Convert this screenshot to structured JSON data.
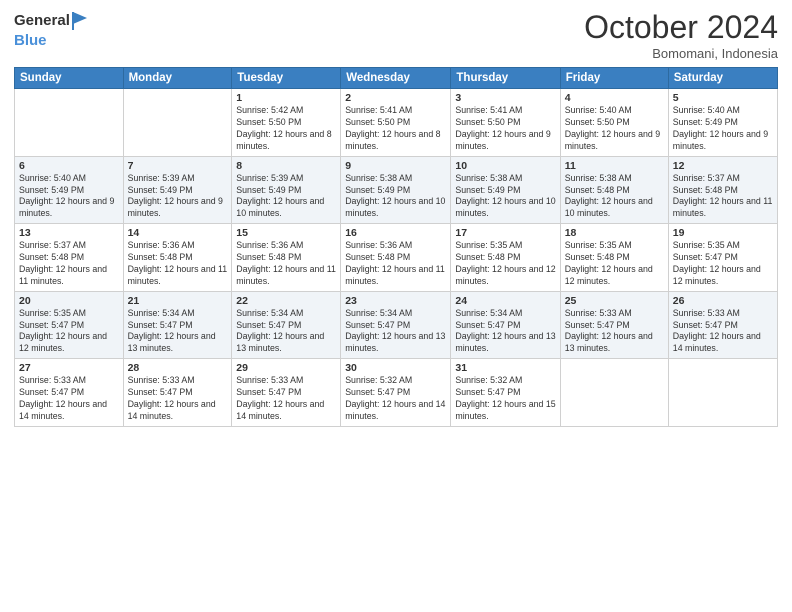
{
  "header": {
    "logo_general": "General",
    "logo_blue": "Blue",
    "month_year": "October 2024",
    "location": "Bomomani, Indonesia"
  },
  "days_of_week": [
    "Sunday",
    "Monday",
    "Tuesday",
    "Wednesday",
    "Thursday",
    "Friday",
    "Saturday"
  ],
  "weeks": [
    [
      {
        "day": "",
        "sunrise": "",
        "sunset": "",
        "daylight": ""
      },
      {
        "day": "",
        "sunrise": "",
        "sunset": "",
        "daylight": ""
      },
      {
        "day": "1",
        "sunrise": "Sunrise: 5:42 AM",
        "sunset": "Sunset: 5:50 PM",
        "daylight": "Daylight: 12 hours and 8 minutes."
      },
      {
        "day": "2",
        "sunrise": "Sunrise: 5:41 AM",
        "sunset": "Sunset: 5:50 PM",
        "daylight": "Daylight: 12 hours and 8 minutes."
      },
      {
        "day": "3",
        "sunrise": "Sunrise: 5:41 AM",
        "sunset": "Sunset: 5:50 PM",
        "daylight": "Daylight: 12 hours and 9 minutes."
      },
      {
        "day": "4",
        "sunrise": "Sunrise: 5:40 AM",
        "sunset": "Sunset: 5:50 PM",
        "daylight": "Daylight: 12 hours and 9 minutes."
      },
      {
        "day": "5",
        "sunrise": "Sunrise: 5:40 AM",
        "sunset": "Sunset: 5:49 PM",
        "daylight": "Daylight: 12 hours and 9 minutes."
      }
    ],
    [
      {
        "day": "6",
        "sunrise": "Sunrise: 5:40 AM",
        "sunset": "Sunset: 5:49 PM",
        "daylight": "Daylight: 12 hours and 9 minutes."
      },
      {
        "day": "7",
        "sunrise": "Sunrise: 5:39 AM",
        "sunset": "Sunset: 5:49 PM",
        "daylight": "Daylight: 12 hours and 9 minutes."
      },
      {
        "day": "8",
        "sunrise": "Sunrise: 5:39 AM",
        "sunset": "Sunset: 5:49 PM",
        "daylight": "Daylight: 12 hours and 10 minutes."
      },
      {
        "day": "9",
        "sunrise": "Sunrise: 5:38 AM",
        "sunset": "Sunset: 5:49 PM",
        "daylight": "Daylight: 12 hours and 10 minutes."
      },
      {
        "day": "10",
        "sunrise": "Sunrise: 5:38 AM",
        "sunset": "Sunset: 5:49 PM",
        "daylight": "Daylight: 12 hours and 10 minutes."
      },
      {
        "day": "11",
        "sunrise": "Sunrise: 5:38 AM",
        "sunset": "Sunset: 5:48 PM",
        "daylight": "Daylight: 12 hours and 10 minutes."
      },
      {
        "day": "12",
        "sunrise": "Sunrise: 5:37 AM",
        "sunset": "Sunset: 5:48 PM",
        "daylight": "Daylight: 12 hours and 11 minutes."
      }
    ],
    [
      {
        "day": "13",
        "sunrise": "Sunrise: 5:37 AM",
        "sunset": "Sunset: 5:48 PM",
        "daylight": "Daylight: 12 hours and 11 minutes."
      },
      {
        "day": "14",
        "sunrise": "Sunrise: 5:36 AM",
        "sunset": "Sunset: 5:48 PM",
        "daylight": "Daylight: 12 hours and 11 minutes."
      },
      {
        "day": "15",
        "sunrise": "Sunrise: 5:36 AM",
        "sunset": "Sunset: 5:48 PM",
        "daylight": "Daylight: 12 hours and 11 minutes."
      },
      {
        "day": "16",
        "sunrise": "Sunrise: 5:36 AM",
        "sunset": "Sunset: 5:48 PM",
        "daylight": "Daylight: 12 hours and 11 minutes."
      },
      {
        "day": "17",
        "sunrise": "Sunrise: 5:35 AM",
        "sunset": "Sunset: 5:48 PM",
        "daylight": "Daylight: 12 hours and 12 minutes."
      },
      {
        "day": "18",
        "sunrise": "Sunrise: 5:35 AM",
        "sunset": "Sunset: 5:48 PM",
        "daylight": "Daylight: 12 hours and 12 minutes."
      },
      {
        "day": "19",
        "sunrise": "Sunrise: 5:35 AM",
        "sunset": "Sunset: 5:47 PM",
        "daylight": "Daylight: 12 hours and 12 minutes."
      }
    ],
    [
      {
        "day": "20",
        "sunrise": "Sunrise: 5:35 AM",
        "sunset": "Sunset: 5:47 PM",
        "daylight": "Daylight: 12 hours and 12 minutes."
      },
      {
        "day": "21",
        "sunrise": "Sunrise: 5:34 AM",
        "sunset": "Sunset: 5:47 PM",
        "daylight": "Daylight: 12 hours and 13 minutes."
      },
      {
        "day": "22",
        "sunrise": "Sunrise: 5:34 AM",
        "sunset": "Sunset: 5:47 PM",
        "daylight": "Daylight: 12 hours and 13 minutes."
      },
      {
        "day": "23",
        "sunrise": "Sunrise: 5:34 AM",
        "sunset": "Sunset: 5:47 PM",
        "daylight": "Daylight: 12 hours and 13 minutes."
      },
      {
        "day": "24",
        "sunrise": "Sunrise: 5:34 AM",
        "sunset": "Sunset: 5:47 PM",
        "daylight": "Daylight: 12 hours and 13 minutes."
      },
      {
        "day": "25",
        "sunrise": "Sunrise: 5:33 AM",
        "sunset": "Sunset: 5:47 PM",
        "daylight": "Daylight: 12 hours and 13 minutes."
      },
      {
        "day": "26",
        "sunrise": "Sunrise: 5:33 AM",
        "sunset": "Sunset: 5:47 PM",
        "daylight": "Daylight: 12 hours and 14 minutes."
      }
    ],
    [
      {
        "day": "27",
        "sunrise": "Sunrise: 5:33 AM",
        "sunset": "Sunset: 5:47 PM",
        "daylight": "Daylight: 12 hours and 14 minutes."
      },
      {
        "day": "28",
        "sunrise": "Sunrise: 5:33 AM",
        "sunset": "Sunset: 5:47 PM",
        "daylight": "Daylight: 12 hours and 14 minutes."
      },
      {
        "day": "29",
        "sunrise": "Sunrise: 5:33 AM",
        "sunset": "Sunset: 5:47 PM",
        "daylight": "Daylight: 12 hours and 14 minutes."
      },
      {
        "day": "30",
        "sunrise": "Sunrise: 5:32 AM",
        "sunset": "Sunset: 5:47 PM",
        "daylight": "Daylight: 12 hours and 14 minutes."
      },
      {
        "day": "31",
        "sunrise": "Sunrise: 5:32 AM",
        "sunset": "Sunset: 5:47 PM",
        "daylight": "Daylight: 12 hours and 15 minutes."
      },
      {
        "day": "",
        "sunrise": "",
        "sunset": "",
        "daylight": ""
      },
      {
        "day": "",
        "sunrise": "",
        "sunset": "",
        "daylight": ""
      }
    ]
  ]
}
